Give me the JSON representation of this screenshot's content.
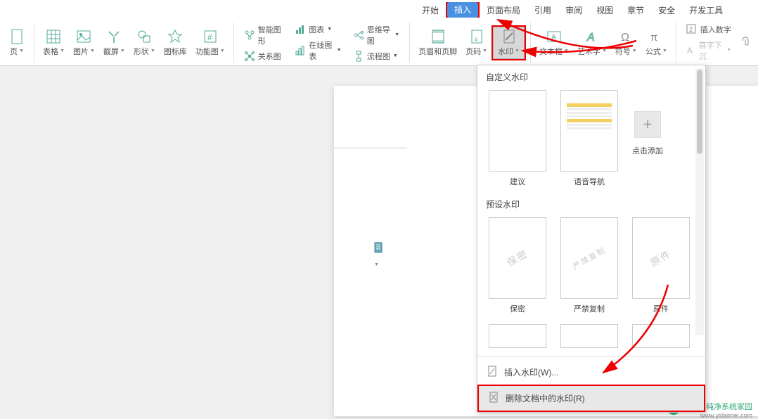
{
  "titlebar": {
    "icons": [
      "save",
      "open",
      "print",
      "preview",
      "undo",
      "redo"
    ]
  },
  "menubar": {
    "items": [
      "开始",
      "插入",
      "页面布局",
      "引用",
      "审阅",
      "视图",
      "章节",
      "安全",
      "开发工具"
    ],
    "active_index": 1
  },
  "ribbon": {
    "page_dropdown": "页",
    "table": "表格",
    "picture": "图片",
    "screenshot": "截屏",
    "shapes": "形状",
    "icons": "图标库",
    "function": "功能图",
    "smartart": "智能图形",
    "chart": "图表",
    "relation": "关系图",
    "online_chart": "在线图表",
    "mindmap": "思维导图",
    "flowchart": "流程图",
    "header_footer": "页眉和页脚",
    "page_number": "页码",
    "watermark": "水印",
    "textbox": "文本框",
    "wordart": "艺术字",
    "symbol": "符号",
    "equation": "公式",
    "insert_number": "插入数字",
    "drop_cap": "首字下沉"
  },
  "dropdown": {
    "custom_title": "自定义水印",
    "custom_items": [
      "建议",
      "语音导航"
    ],
    "add_label": "点击添加",
    "preset_title": "预设水印",
    "preset_items": [
      "保密",
      "严禁复制",
      "原件"
    ],
    "insert_wm": "插入水印(W)...",
    "remove_wm": "删除文档中的水印(R)"
  },
  "footer": {
    "brand": "纯净系统家园",
    "url": "www.yidaimei.com"
  }
}
